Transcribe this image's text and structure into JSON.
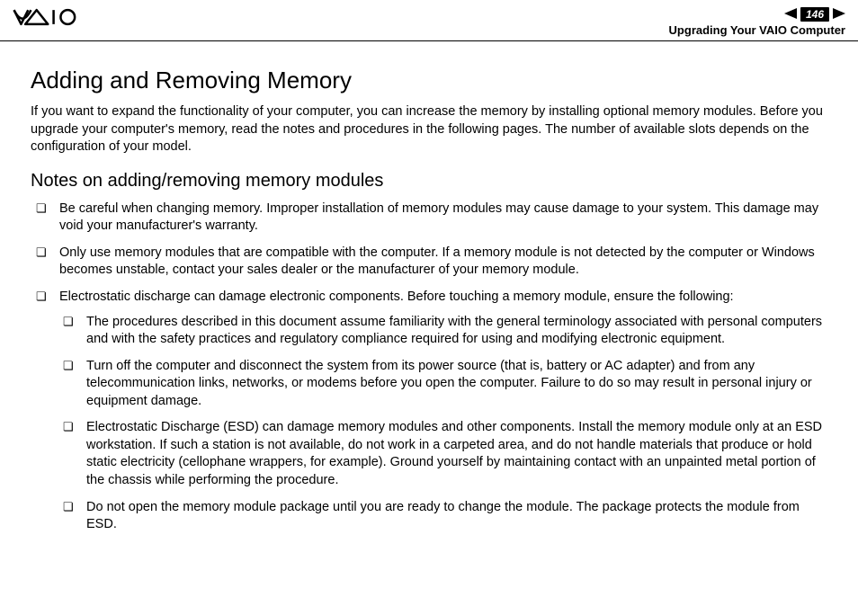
{
  "header": {
    "page_number": "146",
    "breadcrumb": "Upgrading Your VAIO Computer"
  },
  "main": {
    "title": "Adding and Removing Memory",
    "intro": "If you want to expand the functionality of your computer, you can increase the memory by installing optional memory modules. Before you upgrade your computer's memory, read the notes and procedures in the following pages. The number of available slots depends on the configuration of your model.",
    "subtitle": "Notes on adding/removing memory modules",
    "notes": [
      "Be careful when changing memory. Improper installation of memory modules may cause damage to your system. This damage may void your manufacturer's warranty.",
      "Only use memory modules that are compatible with the computer. If a memory module is not detected by the computer or Windows becomes unstable, contact your sales dealer or the manufacturer of your memory module.",
      "Electrostatic discharge can damage electronic components. Before touching a memory module, ensure the following:"
    ],
    "subnotes": [
      "The procedures described in this document assume familiarity with the general terminology associated with personal computers and with the safety practices and regulatory compliance required for using and modifying electronic equipment.",
      "Turn off the computer and disconnect the system from its power source (that is, battery or AC adapter) and from any telecommunication links, networks, or modems before you open the computer. Failure to do so may result in personal injury or equipment damage.",
      "Electrostatic Discharge (ESD) can damage memory modules and other components. Install the memory module only at an ESD workstation. If such a station is not available, do not work in a carpeted area, and do not handle materials that produce or hold static electricity (cellophane wrappers, for example). Ground yourself by maintaining contact with an unpainted metal portion of the chassis while performing the procedure.",
      "Do not open the memory module package until you are ready to change the module. The package protects the module from ESD."
    ]
  }
}
